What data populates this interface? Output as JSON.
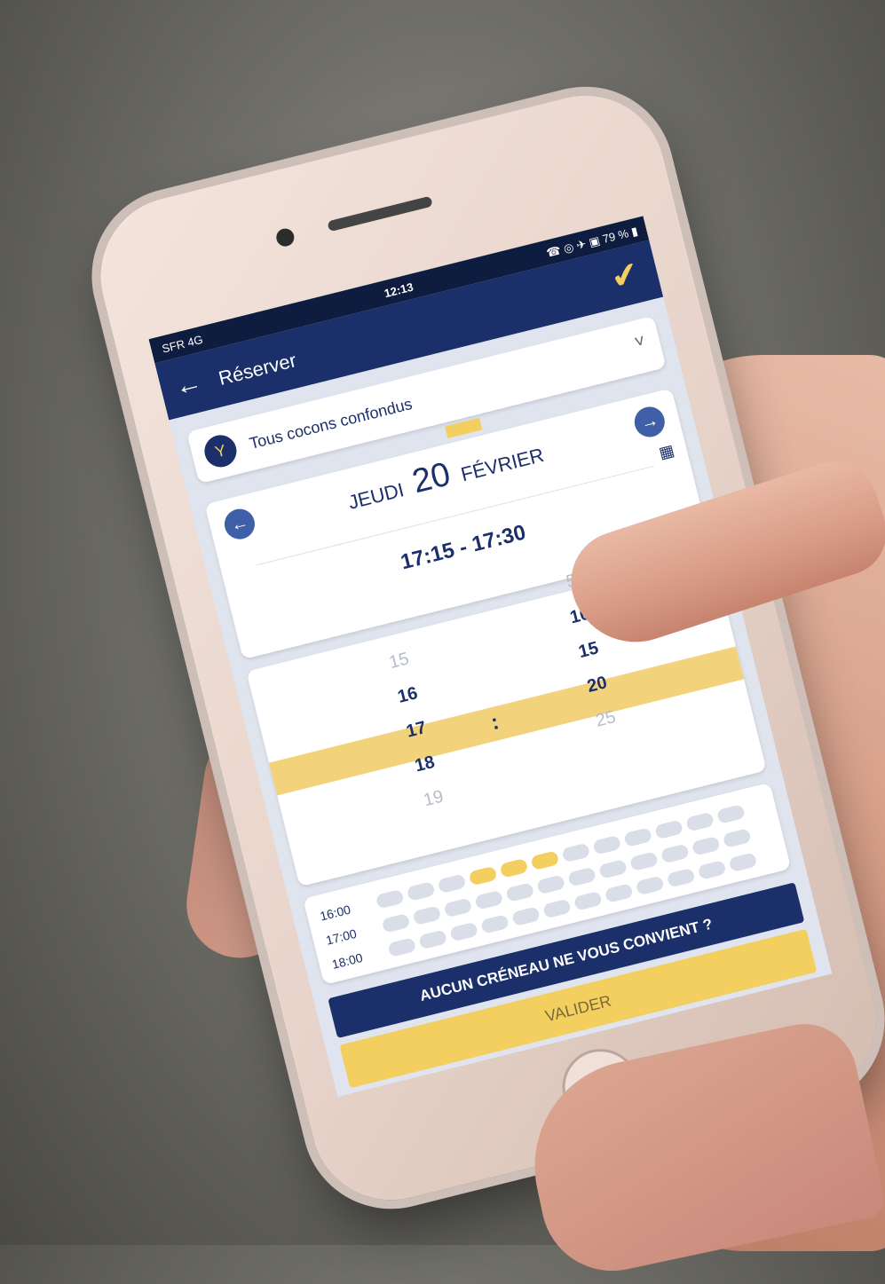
{
  "status_bar": {
    "carrier": "SFR 4G",
    "time": "12:13",
    "icons": "☎ ◎ ✈ ▣ 79 % ▮"
  },
  "header": {
    "back_icon": "←",
    "title": "Réserver",
    "confirm_icon": "✔"
  },
  "filter": {
    "icon": "Y",
    "label": "Tous cocons confondus",
    "chevron": "˅"
  },
  "date": {
    "prev_icon": "←",
    "next_icon": "→",
    "weekday": "JEUDI",
    "day": "20",
    "month": "FÉVRIER",
    "calendar_icon": "▦",
    "time_range": "17:15 - 17:30"
  },
  "picker": {
    "hours": [
      "15",
      "16",
      "17",
      "18",
      "19"
    ],
    "separator": ":",
    "minutes": [
      "5",
      "10",
      "15",
      "20",
      "25"
    ],
    "selected_hour": "17",
    "selected_minute": "15"
  },
  "slots": {
    "rows": [
      "16:00",
      "17:00",
      "18:00"
    ]
  },
  "buttons": {
    "alternative": "AUCUN CRÉNEAU NE VOUS CONVIENT ?",
    "validate": "VALIDER"
  },
  "colors": {
    "navy": "#1b2f6b",
    "yellow": "#f3cf5f",
    "light": "#dfe4ef"
  }
}
